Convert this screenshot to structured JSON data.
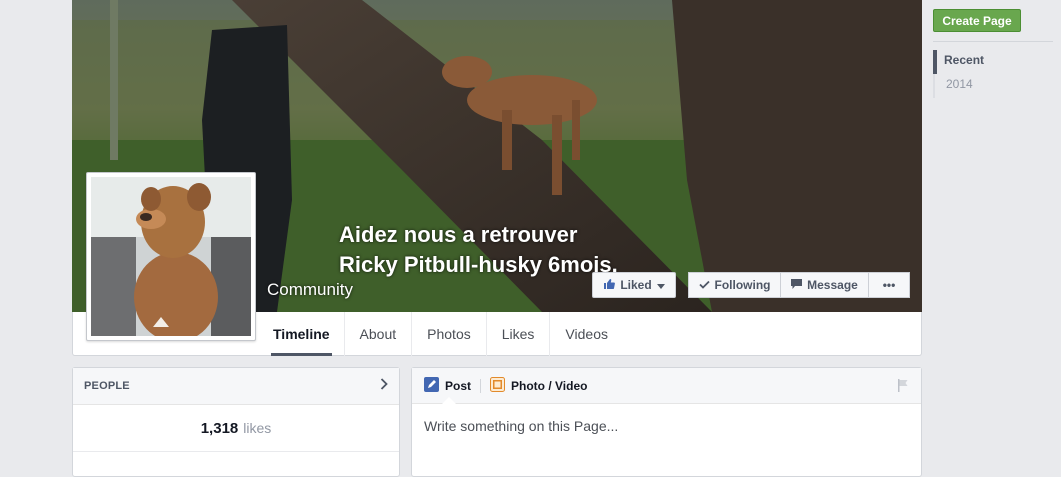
{
  "page": {
    "name_line1": "Aidez nous a retrouver",
    "name_line2": "Ricky Pitbull-husky 6mois.",
    "category": "Community"
  },
  "actions": {
    "liked_label": "Liked",
    "following_label": "Following",
    "message_label": "Message",
    "more_label": "•••"
  },
  "nav": {
    "tabs": [
      {
        "label": "Timeline",
        "active": true
      },
      {
        "label": "About"
      },
      {
        "label": "Photos"
      },
      {
        "label": "Likes"
      },
      {
        "label": "Videos"
      }
    ]
  },
  "sidebar": {
    "create_page_label": "Create Page",
    "scrubber": [
      {
        "label": "Recent",
        "active": true
      },
      {
        "label": "2014"
      }
    ]
  },
  "people": {
    "heading": "PEOPLE",
    "likes_count": "1,318",
    "likes_label": "likes"
  },
  "composer": {
    "post_label": "Post",
    "photo_video_label": "Photo / Video",
    "placeholder": "Write something on this Page..."
  },
  "colors": {
    "create_page_green": "#69a74e",
    "active_tab_underline": "#4e5665",
    "post_icon_blue": "#4267b2",
    "photo_icon_orange": "#e28a2b"
  },
  "icons": [
    "thumbs-up-icon",
    "caret-down-icon",
    "checkmark-icon",
    "message-icon",
    "chevron-right-icon",
    "pencil-icon",
    "photo-icon",
    "flag-icon"
  ]
}
